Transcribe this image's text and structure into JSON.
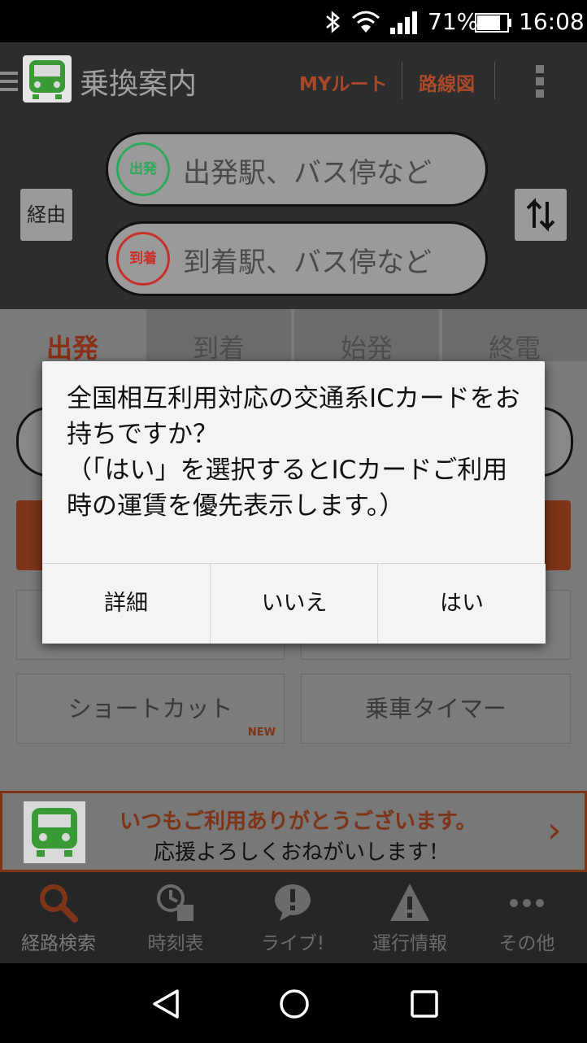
{
  "status_bar": {
    "battery": "71%",
    "time": "16:08"
  },
  "app_bar": {
    "title": "乗換案内",
    "my_route": "MYルート",
    "route_map": "路線図"
  },
  "search": {
    "via_label": "経由",
    "departure_badge": "出発",
    "departure_placeholder": "出発駅、バス停など",
    "arrival_badge": "到着",
    "arrival_placeholder": "到着駅、バス停など"
  },
  "tabs": [
    {
      "label": "出発"
    },
    {
      "label": "到着"
    },
    {
      "label": "始発"
    },
    {
      "label": "終電"
    }
  ],
  "cards": {
    "shortcut": "ショートカット",
    "shortcut_badge": "NEW",
    "timer": "乗車タイマー"
  },
  "banner": {
    "line1": "いつもご利用ありがとうございます。",
    "line2": "応援よろしくおねがいします！",
    "arrow": "›"
  },
  "bottom_nav": [
    {
      "label": "経路検索"
    },
    {
      "label": "時刻表"
    },
    {
      "label": "ライブ!"
    },
    {
      "label": "運行情報"
    },
    {
      "label": "その他"
    }
  ],
  "dialog": {
    "message": "全国相互利用対応の交通系ICカードをお持ちですか？\n（「はい」を選択するとICカードご利用時の運賃を優先表示します。）",
    "buttons": {
      "details": "詳細",
      "no": "いいえ",
      "yes": "はい"
    }
  },
  "colors": {
    "accent": "#e8572a",
    "departure_green": "#2eaa5c",
    "arrival_red": "#c9302c",
    "train_green": "#3a9a35"
  }
}
